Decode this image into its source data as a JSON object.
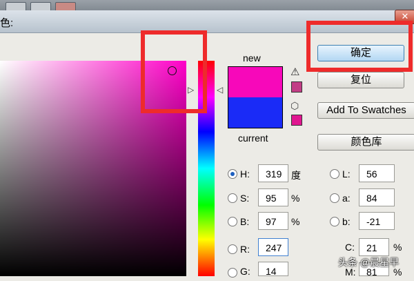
{
  "window": {
    "title": "色:",
    "close_icon": "close-icon"
  },
  "swatch": {
    "new_label": "new",
    "current_label": "current",
    "new_color": "#f708ba",
    "current_color": "#1a2bf7"
  },
  "buttons": {
    "ok": "确定",
    "reset": "复位",
    "add_to_swatches": "Add To Swatches",
    "color_libraries": "颜色库"
  },
  "hsb": {
    "h": {
      "label": "H:",
      "value": "319",
      "unit": "度"
    },
    "s": {
      "label": "S:",
      "value": "95",
      "unit": "%"
    },
    "b": {
      "label": "B:",
      "value": "97",
      "unit": "%"
    }
  },
  "rgb": {
    "r": {
      "label": "R:",
      "value": "247"
    },
    "g": {
      "label": "G:",
      "value": "14"
    }
  },
  "lab": {
    "l": {
      "label": "L:",
      "value": "56"
    },
    "a": {
      "label": "a:",
      "value": "84"
    },
    "b": {
      "label": "b:",
      "value": "-21"
    }
  },
  "cmyk": {
    "c": {
      "label": "C:",
      "value": "21",
      "unit": "%"
    },
    "m": {
      "label": "M:",
      "value": "81",
      "unit": "%"
    }
  },
  "watermark": "头条 @晨星早",
  "colors": {
    "highlight": "#ee2b2b",
    "web_safe_swatch": "#e01690"
  }
}
